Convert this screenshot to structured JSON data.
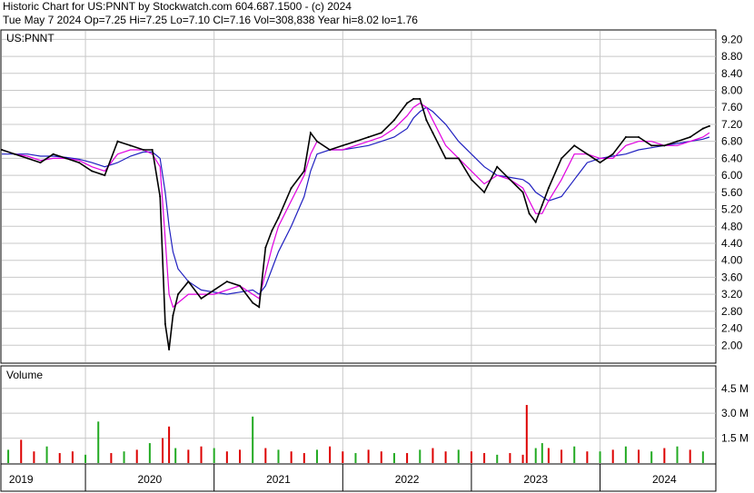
{
  "header": {
    "line1": "Historic Chart for US:PNNT by Stockwatch.com 604.687.1500 - (c) 2024",
    "line2": "Tue May  7 2024   Op=7.25  Hi=7.25  Lo=7.10  Cl=7.16  Vol=308,838  Year hi=8.02  lo=1.76"
  },
  "price_panel": {
    "label": "US:PNNT"
  },
  "volume_panel": {
    "label": "Volume"
  },
  "colors": {
    "price": "#000000",
    "ma_short": "#e000e0",
    "ma_long": "#2020c0",
    "volume_up": "#22aa22",
    "volume_down": "#dd0000",
    "grid": "#c8c8c8"
  },
  "chart_data": [
    {
      "type": "line",
      "name": "price",
      "title": "US:PNNT",
      "y_ticks": [
        "9.20",
        "8.80",
        "8.40",
        "8.00",
        "7.60",
        "7.20",
        "6.80",
        "6.40",
        "6.00",
        "5.60",
        "5.20",
        "4.80",
        "4.40",
        "4.00",
        "3.60",
        "3.20",
        "2.80",
        "2.40",
        "2.00"
      ],
      "ylim": [
        1.6,
        9.4
      ],
      "xlim": [
        2018.85,
        2024.4
      ],
      "x": [
        2018.85,
        2018.95,
        2019.05,
        2019.15,
        2019.25,
        2019.35,
        2019.45,
        2019.55,
        2019.65,
        2019.75,
        2019.85,
        2019.95,
        2020.02,
        2020.08,
        2020.12,
        2020.15,
        2020.18,
        2020.22,
        2020.3,
        2020.4,
        2020.5,
        2020.6,
        2020.7,
        2020.8,
        2020.85,
        2020.9,
        2020.95,
        2021.0,
        2021.1,
        2021.2,
        2021.25,
        2021.3,
        2021.4,
        2021.5,
        2021.6,
        2021.7,
        2021.8,
        2021.9,
        2022.0,
        2022.05,
        2022.1,
        2022.15,
        2022.2,
        2022.3,
        2022.4,
        2022.5,
        2022.6,
        2022.7,
        2022.8,
        2022.9,
        2022.95,
        2023.0,
        2023.05,
        2023.1,
        2023.2,
        2023.3,
        2023.4,
        2023.5,
        2023.6,
        2023.7,
        2023.8,
        2023.9,
        2024.0,
        2024.1,
        2024.2,
        2024.3,
        2024.35
      ],
      "y": [
        6.6,
        6.5,
        6.4,
        6.3,
        6.5,
        6.4,
        6.3,
        6.1,
        6.0,
        6.8,
        6.7,
        6.6,
        6.6,
        5.5,
        2.5,
        1.9,
        2.7,
        3.2,
        3.5,
        3.1,
        3.3,
        3.5,
        3.4,
        3.0,
        2.9,
        4.3,
        4.7,
        5.0,
        5.7,
        6.1,
        7.0,
        6.8,
        6.6,
        6.7,
        6.8,
        6.9,
        7.0,
        7.3,
        7.7,
        7.8,
        7.8,
        7.3,
        7.0,
        6.4,
        6.4,
        5.9,
        5.6,
        6.2,
        5.9,
        5.6,
        5.1,
        4.9,
        5.3,
        5.7,
        6.4,
        6.7,
        6.5,
        6.3,
        6.5,
        6.9,
        6.9,
        6.7,
        6.7,
        6.8,
        6.9,
        7.1,
        7.16
      ],
      "series": [
        {
          "name": "moving average (short)",
          "values": [
            6.6,
            6.5,
            6.45,
            6.35,
            6.4,
            6.4,
            6.35,
            6.2,
            6.1,
            6.5,
            6.6,
            6.6,
            6.5,
            6.2,
            4.5,
            3.2,
            2.9,
            3.0,
            3.2,
            3.2,
            3.2,
            3.3,
            3.4,
            3.2,
            3.1,
            3.7,
            4.3,
            4.8,
            5.4,
            6.0,
            6.5,
            6.8,
            6.6,
            6.6,
            6.7,
            6.8,
            6.9,
            7.1,
            7.4,
            7.6,
            7.7,
            7.6,
            7.3,
            6.7,
            6.4,
            6.1,
            5.8,
            6.0,
            5.9,
            5.7,
            5.4,
            5.1,
            5.1,
            5.4,
            5.9,
            6.5,
            6.5,
            6.4,
            6.4,
            6.7,
            6.8,
            6.8,
            6.7,
            6.7,
            6.8,
            6.9,
            7.0
          ]
        },
        {
          "name": "moving average (long)",
          "values": [
            6.5,
            6.5,
            6.5,
            6.45,
            6.45,
            6.42,
            6.38,
            6.3,
            6.2,
            6.3,
            6.45,
            6.55,
            6.55,
            6.4,
            5.6,
            4.8,
            4.2,
            3.8,
            3.5,
            3.3,
            3.25,
            3.2,
            3.25,
            3.3,
            3.2,
            3.4,
            3.8,
            4.2,
            4.8,
            5.5,
            6.1,
            6.5,
            6.6,
            6.6,
            6.65,
            6.7,
            6.8,
            6.9,
            7.1,
            7.35,
            7.5,
            7.6,
            7.5,
            7.2,
            6.8,
            6.5,
            6.2,
            6.0,
            5.95,
            5.9,
            5.8,
            5.6,
            5.5,
            5.4,
            5.5,
            5.9,
            6.3,
            6.4,
            6.45,
            6.5,
            6.6,
            6.65,
            6.7,
            6.75,
            6.8,
            6.85,
            6.9
          ]
        }
      ]
    },
    {
      "type": "bar",
      "name": "volume",
      "title": "Volume",
      "y_ticks": [
        "4.5 M",
        "3.0 M",
        "1.5 M"
      ],
      "ylim": [
        0,
        5.8
      ],
      "xlim": [
        2018.85,
        2024.4
      ],
      "x": [
        2018.9,
        2019.0,
        2019.1,
        2019.2,
        2019.3,
        2019.4,
        2019.5,
        2019.6,
        2019.7,
        2019.8,
        2019.9,
        2020.0,
        2020.1,
        2020.15,
        2020.2,
        2020.3,
        2020.4,
        2020.5,
        2020.6,
        2020.7,
        2020.8,
        2020.9,
        2021.0,
        2021.1,
        2021.2,
        2021.3,
        2021.4,
        2021.5,
        2021.6,
        2021.7,
        2021.8,
        2021.9,
        2022.0,
        2022.1,
        2022.2,
        2022.3,
        2022.4,
        2022.5,
        2022.6,
        2022.7,
        2022.8,
        2022.9,
        2022.93,
        2023.0,
        2023.05,
        2023.1,
        2023.2,
        2023.3,
        2023.4,
        2023.5,
        2023.6,
        2023.7,
        2023.8,
        2023.9,
        2024.0,
        2024.1,
        2024.2,
        2024.3
      ],
      "values": [
        0.8,
        1.4,
        0.7,
        1.0,
        0.6,
        0.7,
        0.5,
        2.5,
        0.6,
        0.7,
        0.8,
        1.2,
        1.5,
        2.2,
        0.9,
        0.8,
        1.0,
        0.9,
        0.7,
        0.8,
        2.8,
        0.9,
        0.8,
        0.7,
        0.6,
        0.8,
        1.0,
        0.7,
        0.6,
        0.8,
        0.7,
        0.6,
        0.6,
        0.8,
        0.9,
        0.7,
        0.8,
        0.7,
        0.6,
        0.5,
        0.6,
        0.5,
        3.5,
        0.9,
        1.2,
        0.9,
        0.8,
        1.0,
        0.7,
        0.7,
        0.8,
        1.0,
        0.8,
        0.7,
        0.9,
        1.0,
        0.8,
        0.7
      ],
      "colors_key": [
        "up",
        "down",
        "down",
        "up",
        "down",
        "down",
        "up",
        "up",
        "down",
        "up",
        "down",
        "up",
        "down",
        "down",
        "up",
        "down",
        "down",
        "up",
        "down",
        "down",
        "up",
        "down",
        "up",
        "down",
        "down",
        "up",
        "down",
        "down",
        "up",
        "down",
        "down",
        "up",
        "down",
        "up",
        "down",
        "down",
        "up",
        "down",
        "down",
        "up",
        "down",
        "down",
        "down",
        "up",
        "up",
        "down",
        "down",
        "up",
        "down",
        "up",
        "down",
        "up",
        "down",
        "up",
        "down",
        "up",
        "down",
        "up"
      ]
    }
  ],
  "x_axis": {
    "labels": [
      "2019",
      "2020",
      "2021",
      "2022",
      "2023",
      "2024"
    ],
    "values": [
      2019.0,
      2020.0,
      2021.0,
      2022.0,
      2023.0,
      2024.0
    ],
    "boundaries": [
      2018.85,
      2019.5,
      2020.5,
      2021.5,
      2022.5,
      2023.5,
      2024.4
    ]
  }
}
